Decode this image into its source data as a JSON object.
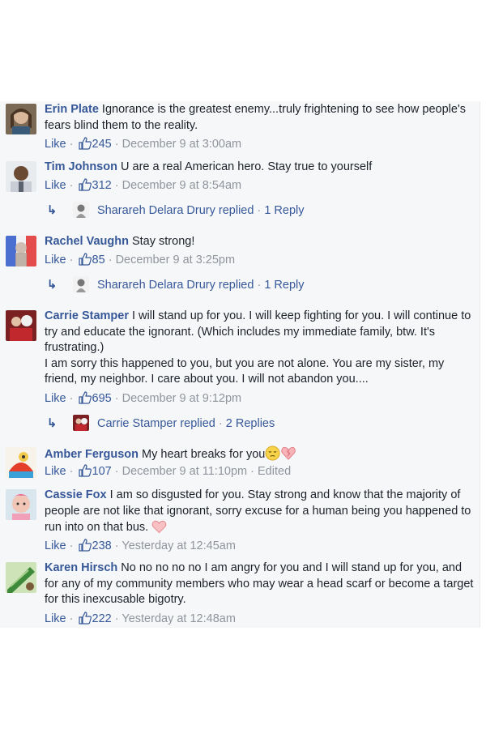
{
  "comments": [
    {
      "name": "Erin Plate",
      "text": "Ignorance is the greatest enemy...truly frightening to see how people's fears blind them to the reality.",
      "like": "Like",
      "count": "245",
      "time": "December 9 at 3:00am"
    },
    {
      "name": "Tim Johnson",
      "text": "U are a real American hero. Stay true to yourself",
      "like": "Like",
      "count": "312",
      "time": "December 9 at 8:54am",
      "reply": {
        "who": "Sharareh Delara Drury replied",
        "count": "1 Reply"
      }
    },
    {
      "name": "Rachel Vaughn",
      "text": "Stay strong!",
      "like": "Like",
      "count": "85",
      "time": "December 9 at 3:25pm",
      "reply": {
        "who": "Sharareh Delara Drury replied",
        "count": "1 Reply"
      }
    },
    {
      "name": "Carrie Stamper",
      "text": "I will stand up for you. I will keep fighting for you. I will continue to try and educate the ignorant. (Which includes my immediate family, btw. It's frustrating.)",
      "text2": "I am sorry this happened to you, but you are not alone. You are my sister, my friend, my neighbor. I care about you. I will not abandon you....",
      "like": "Like",
      "count": "695",
      "time": "December 9 at 9:12pm",
      "reply": {
        "who": "Carrie Stamper replied",
        "count": "2 Replies"
      }
    },
    {
      "name": "Amber Ferguson",
      "text": "My heart breaks for you",
      "like": "Like",
      "count": "107",
      "time": "December 9 at 11:10pm",
      "edited": "Edited"
    },
    {
      "name": "Cassie Fox",
      "text": "I am so disgusted for you. Stay strong and know that the majority of people are not like that ignorant, sorry excuse for a human being you happened to run into on that bus.",
      "like": "Like",
      "count": "238",
      "time": "Yesterday at 12:45am"
    },
    {
      "name": "Karen Hirsch",
      "text": "No no no no no I am angry for you and I will stand up for you, and for any of my community members who may wear a head scarf or become a target for this inexcusable bigotry.",
      "like": "Like",
      "count": "222",
      "time": "Yesterday at 12:48am"
    }
  ],
  "separator": "·",
  "colors": {
    "link": "#365899",
    "meta": "#90949c",
    "panel": "#f6f7f9"
  }
}
